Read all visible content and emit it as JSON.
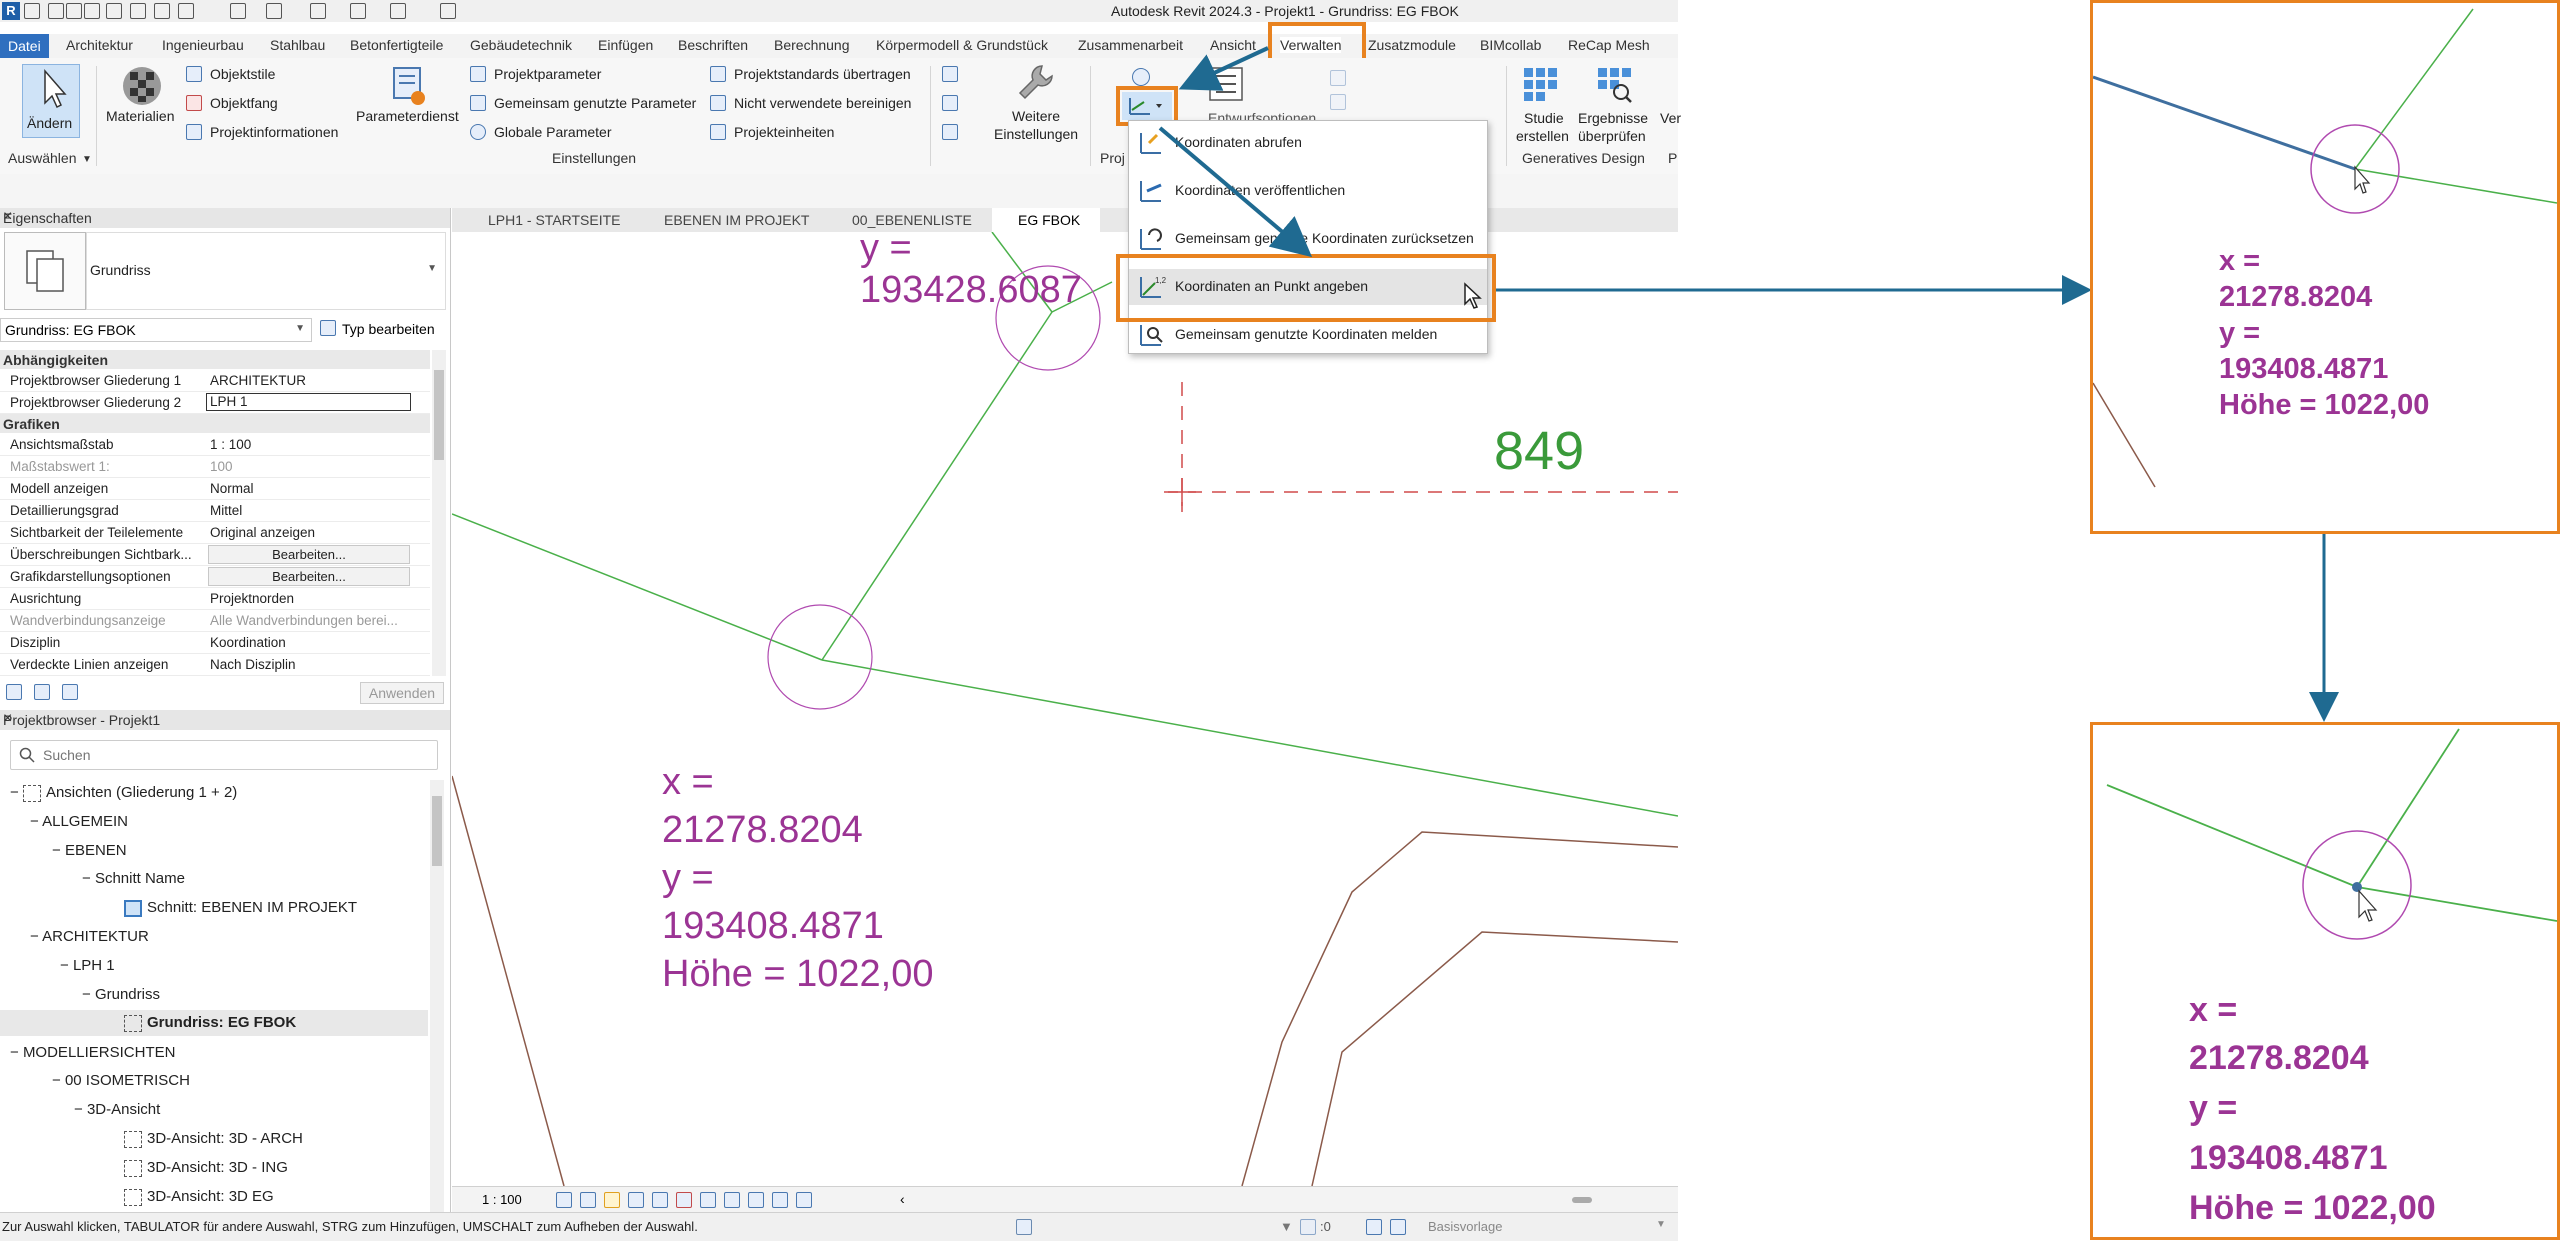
{
  "window": {
    "title": "Autodesk Revit 2024.3 - Projekt1 - Grundriss: EG FBOK"
  },
  "ribbon_tabs": [
    "Datei",
    "Architektur",
    "Ingenieurbau",
    "Stahlbau",
    "Betonfertigteile",
    "Gebäudetechnik",
    "Einfügen",
    "Beschriften",
    "Berechnung",
    "Körpermodell & Grundstück",
    "Zusammenarbeit",
    "Ansicht",
    "Verwalten",
    "Zusatzmodule",
    "BIMcollab",
    "ReCap Mesh"
  ],
  "ribbon": {
    "select": {
      "modify": "Ändern",
      "group": "Auswählen"
    },
    "materials": "Materialien",
    "settings": {
      "object_styles": "Objektstile",
      "snaps": "Objektfang",
      "project_info": "Projektinformationen",
      "parameter_service": "Parameterdienst",
      "project_params": "Projektparameter",
      "shared_params": "Gemeinsam genutzte Parameter",
      "global_params": "Globale  Parameter",
      "transfer_standards": "Projektstandards übertragen",
      "purge": "Nicht verwendete bereinigen",
      "units": "Projekteinheiten",
      "more_top": "Weitere",
      "more_bottom": "Einstellungen",
      "group": "Einstellungen"
    },
    "design_options": "Entwurfsoptionen",
    "generative": {
      "study_top": "Studie",
      "study_bottom": "erstellen",
      "results_top": "Ergebnisse",
      "results_bottom": "überprüfen",
      "group": "Generatives Design"
    },
    "cut_proj": "Proj",
    "cut_ver": "Ver",
    "cut_p": "P"
  },
  "dropdown": {
    "items": [
      "Koordinaten abrufen",
      "Koordinaten veröffentlichen",
      "Gemeinsam genutzte Koordinaten zurücksetzen",
      "Koordinaten an Punkt angeben",
      "Gemeinsam genutzte Koordinaten melden"
    ]
  },
  "properties": {
    "header": "Eigenschaften",
    "type_name": "Grundriss",
    "instance": "Grundriss: EG FBOK",
    "edit_type": "Typ bearbeiten",
    "sections": {
      "dependencies": "Abhängigkeiten",
      "graphics": "Grafiken"
    },
    "rows_dep": [
      {
        "k": "Projektbrowser Gliederung 1",
        "v": "ARCHITEKTUR"
      },
      {
        "k": "Projektbrowser Gliederung 2",
        "v": "LPH 1"
      }
    ],
    "rows_gfx": [
      {
        "k": "Ansichtsmaßstab",
        "v": "1 : 100"
      },
      {
        "k": "Maßstabswert 1:",
        "v": "100"
      },
      {
        "k": "Modell anzeigen",
        "v": "Normal"
      },
      {
        "k": "Detaillierungsgrad",
        "v": "Mittel"
      },
      {
        "k": "Sichtbarkeit der Teilelemente",
        "v": "Original anzeigen"
      },
      {
        "k": "Überschreibungen Sichtbark...",
        "v": "Bearbeiten..."
      },
      {
        "k": "Grafikdarstellungsoptionen",
        "v": "Bearbeiten..."
      },
      {
        "k": "Ausrichtung",
        "v": "Projektnorden"
      },
      {
        "k": "Wandverbindungsanzeige",
        "v": "Alle Wandverbindungen berei..."
      },
      {
        "k": "Disziplin",
        "v": "Koordination"
      },
      {
        "k": "Verdeckte Linien anzeigen",
        "v": "Nach Disziplin"
      }
    ],
    "apply": "Anwenden"
  },
  "browser": {
    "header": "Projektbrowser - Projekt1",
    "search_placeholder": "Suchen",
    "items": [
      "Ansichten (Gliederung 1 + 2)",
      "ALLGEMEIN",
      "EBENEN",
      "Schnitt Name",
      "Schnitt: EBENEN IM PROJEKT",
      "ARCHITEKTUR",
      "LPH 1",
      "Grundriss",
      "Grundriss: EG FBOK",
      "MODELLIERSICHTEN",
      "00 ISOMETRISCH",
      "3D-Ansicht",
      "3D-Ansicht: 3D - ARCH",
      "3D-Ansicht: 3D - ING",
      "3D-Ansicht: 3D EG"
    ]
  },
  "view_tabs": [
    "LPH1 - STARTSEITE",
    "EBENEN IM PROJEKT",
    "00_EBENENLISTE",
    "EG FBOK"
  ],
  "canvas": {
    "top_label": "y =",
    "top_value": "193428.6087",
    "number": "849",
    "x_label": "x =",
    "x_value": "21278.8204",
    "y_label": "y =",
    "y_value": "193408.4871",
    "height": "Höhe = 1022,00"
  },
  "view_control": {
    "scale": "1 : 100"
  },
  "status": {
    "text": "Zur Auswahl klicken, TABULATOR für andere Auswahl, STRG zum Hinzufügen, UMSCHALT zum Aufheben der Auswahl.",
    "count": ":0",
    "template": "Basisvorlage"
  },
  "zoom_top": {
    "x_label": "x =",
    "x_value": "21278.8204",
    "y_label": "y =",
    "y_value": "193408.4871",
    "height": "Höhe = 1022,00"
  },
  "zoom_bottom": {
    "x_label": "x =",
    "x_value": "21278.8204",
    "y_label": "y =",
    "y_value": "193408.4871",
    "height": "Höhe = 1022,00"
  },
  "colors": {
    "accent_orange": "#e8821f",
    "arrow_blue": "#1f6a91",
    "coord_purple": "#9b3494",
    "line_green": "#4ab04a",
    "line_brown": "#8b5a4a",
    "revit_blue": "#2f6fbf"
  }
}
